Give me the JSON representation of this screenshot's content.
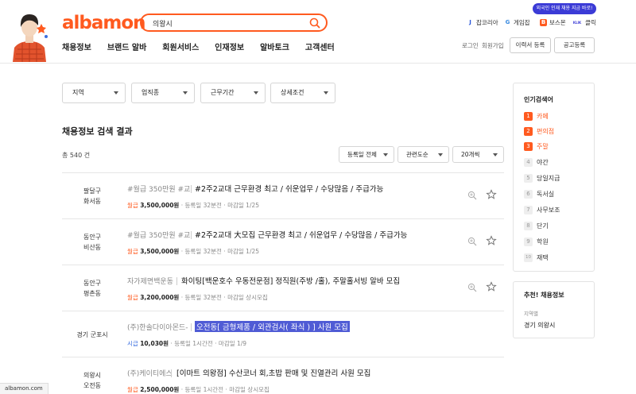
{
  "header": {
    "logo": "albamon",
    "search_value": "의왕시",
    "badge": "외국인 인재 채용 지금 바로!",
    "family": [
      "잡코리아",
      "게임잡",
      "보스몬",
      "클릭"
    ],
    "family_icons": [
      "J",
      "G",
      "B",
      "KLIK"
    ],
    "gnb": [
      "채용정보",
      "브랜드 알바",
      "회원서비스",
      "인재정보",
      "알바토크",
      "고객센터"
    ],
    "login": "로그인",
    "signup": "회원가입",
    "resume_btn": "이력서 등록",
    "post_btn": "공고등록"
  },
  "filters": [
    "지역",
    "업직종",
    "근무기간",
    "상세조건"
  ],
  "result_title": "채용정보 검색 결과",
  "total": "총 540 건",
  "sorts": [
    "등록일 전체",
    "관련도순",
    "20개씩"
  ],
  "jobs": [
    {
      "loc1": "팔달구",
      "loc2": "화서동",
      "company": "#월급 350만원 #교",
      "title": "#2주2교대 근무환경 최고 / 쉬운업무 / 수당많음 / 주급가능",
      "pay_type": "월급",
      "pay": "3,500,000원",
      "posted": "등록일 32분전",
      "deadline": "마감일 1/25"
    },
    {
      "loc1": "동안구",
      "loc2": "비산동",
      "company": "#월급 350만원 #교",
      "title": "#2주2교대 大모집 근무환경 최고 / 쉬운업무 / 수당많음 / 주급가능",
      "pay_type": "월급",
      "pay": "3,500,000원",
      "posted": "등록일 32분전",
      "deadline": "마감일 1/25"
    },
    {
      "loc1": "동안구",
      "loc2": "평촌동",
      "company": "자가제면백운동",
      "title": "화이팅[백운호수 우동전문점] 정직원(주방 /홀), 주말홀서빙 알바 모집",
      "pay_type": "월급",
      "pay": "3,200,000원",
      "posted": "등록일 32분전",
      "deadline": "마감일 상시모집"
    },
    {
      "loc1": "경기 군포시",
      "loc2": "",
      "company": "(주)한솔다이아몬드-",
      "title": "오전동[ 금형제품 / 외관검사( 좌식 ) ] 사원 모집",
      "pay_type": "시급",
      "pay": "10,030원",
      "posted": "등록일 1시간전",
      "deadline": "마감일 1/9"
    },
    {
      "loc1": "의왕시",
      "loc2": "오전동",
      "company": "(주)케이티에스",
      "title": "[이마트 의왕점] 수산코너 회,초밥 판매 및 진열관리 사원 모집",
      "pay_type": "월급",
      "pay": "2,500,000원",
      "posted": "등록일 1시간전",
      "deadline": "마감일 상시모집"
    }
  ],
  "popular": {
    "title": "인기검색어",
    "items": [
      "카페",
      "편의점",
      "주말",
      "야간",
      "당일지급",
      "독서실",
      "사무보조",
      "단기",
      "학원",
      "재택"
    ],
    "ranks": [
      "1",
      "2",
      "3",
      "4",
      "5",
      "6",
      "7",
      "8",
      "9",
      "10"
    ]
  },
  "recommend": {
    "title": "추천! 채용정보",
    "label": "지역별",
    "value": "경기 의왕시"
  },
  "status_url": "albamon.com",
  "colors": {
    "brand": "#ff5a1f",
    "highlight": "#4f5bd5",
    "badge": "#3b3bd6"
  }
}
